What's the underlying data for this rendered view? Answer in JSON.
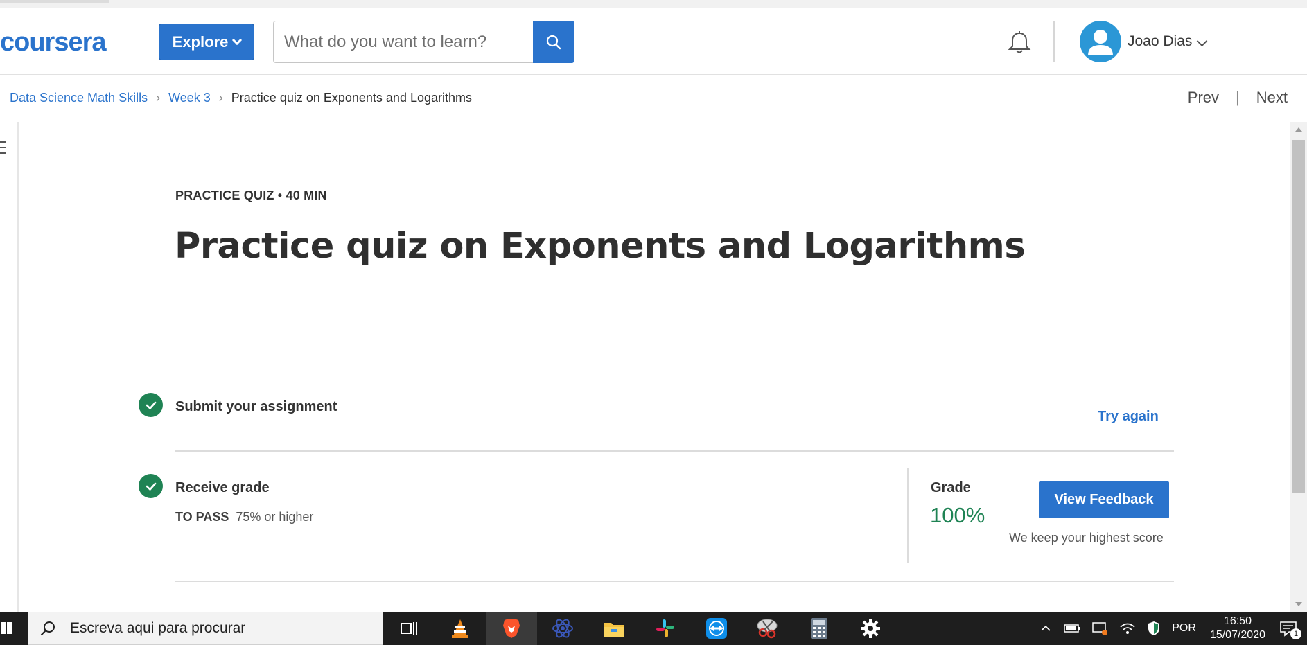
{
  "header": {
    "logo_text": "coursera",
    "explore_label": "Explore",
    "search_placeholder": "What do you want to learn?",
    "user_name": "Joao Dias"
  },
  "breadcrumb": {
    "items": [
      "Data Science Math Skills",
      "Week 3"
    ],
    "current": "Practice quiz on Exponents and Logarithms",
    "prev_label": "Prev",
    "separator": "|",
    "next_label": "Next"
  },
  "quiz": {
    "eyebrow": "PRACTICE QUIZ • 40 MIN",
    "title": "Practice quiz on Exponents and Logarithms",
    "submit_label": "Submit your assignment",
    "try_again_label": "Try again",
    "receive_label": "Receive grade",
    "to_pass_label": "TO PASS",
    "to_pass_value": "75% or higher",
    "grade_label": "Grade",
    "grade_value": "100%",
    "view_feedback_label": "View Feedback",
    "keep_note": "We keep your highest score"
  },
  "taskbar": {
    "search_placeholder": "Escreva aqui para procurar",
    "apps": [
      "task-view-icon",
      "vlc-icon",
      "brave-icon",
      "atom-icon",
      "file-explorer-icon",
      "slack-icon",
      "teamviewer-icon",
      "snipping-tool-icon",
      "calculator-icon",
      "settings-icon"
    ],
    "language": "POR",
    "time": "16:50",
    "date": "15/07/2020",
    "notification_count": "1"
  },
  "colors": {
    "brand": "#2a73cc",
    "success": "#1f8354"
  }
}
